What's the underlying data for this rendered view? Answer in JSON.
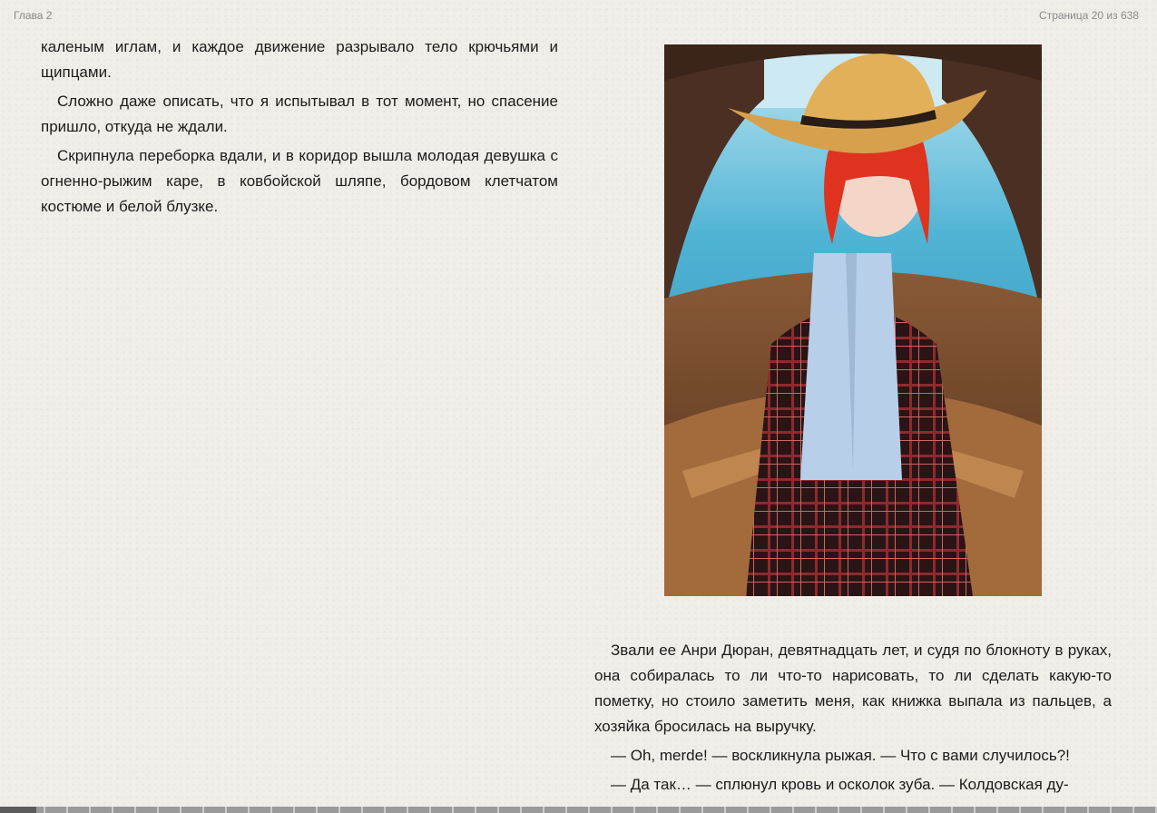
{
  "header": {
    "chapter": "Глава 2",
    "page_status": "Страница 20 из 638"
  },
  "left_column": {
    "paragraphs": [
      "каленым иглам, и каждое движение разрывало тело крючьями и щипцами.",
      "Сложно даже описать, что я испытывал в тот момент, но спасение пришло, откуда не ждали.",
      "Скрипнула переборка вдали, и в коридор вышла молодая девушка с огненно-рыжим каре, в ковбойской шляпе, бордовом клетчатом костюме и белой блузке."
    ]
  },
  "right_column": {
    "paragraphs": [
      "Звали ее Анри Дюран, девятнадцать лет, и судя по блокноту в руках, она собиралась то ли что-то нарисовать, то ли сделать какую-то пометку, но стоило заметить меня, как книжка выпала из пальцев, а хозяйка бросилась на выручку.",
      "— Oh, merde! — воскликнула рыжая. — Что с вами случилось?!",
      "— Да так… — сплюнул кровь и осколок зуба. — Колдовская ду-"
    ]
  },
  "illustration": {
    "icon": "illustration-image"
  },
  "progress": {
    "current_page": 20,
    "total_pages": 638
  },
  "colors": {
    "background": "#f1eee9",
    "header_text": "#8a8a8a",
    "body_text": "#1c1c1c"
  }
}
